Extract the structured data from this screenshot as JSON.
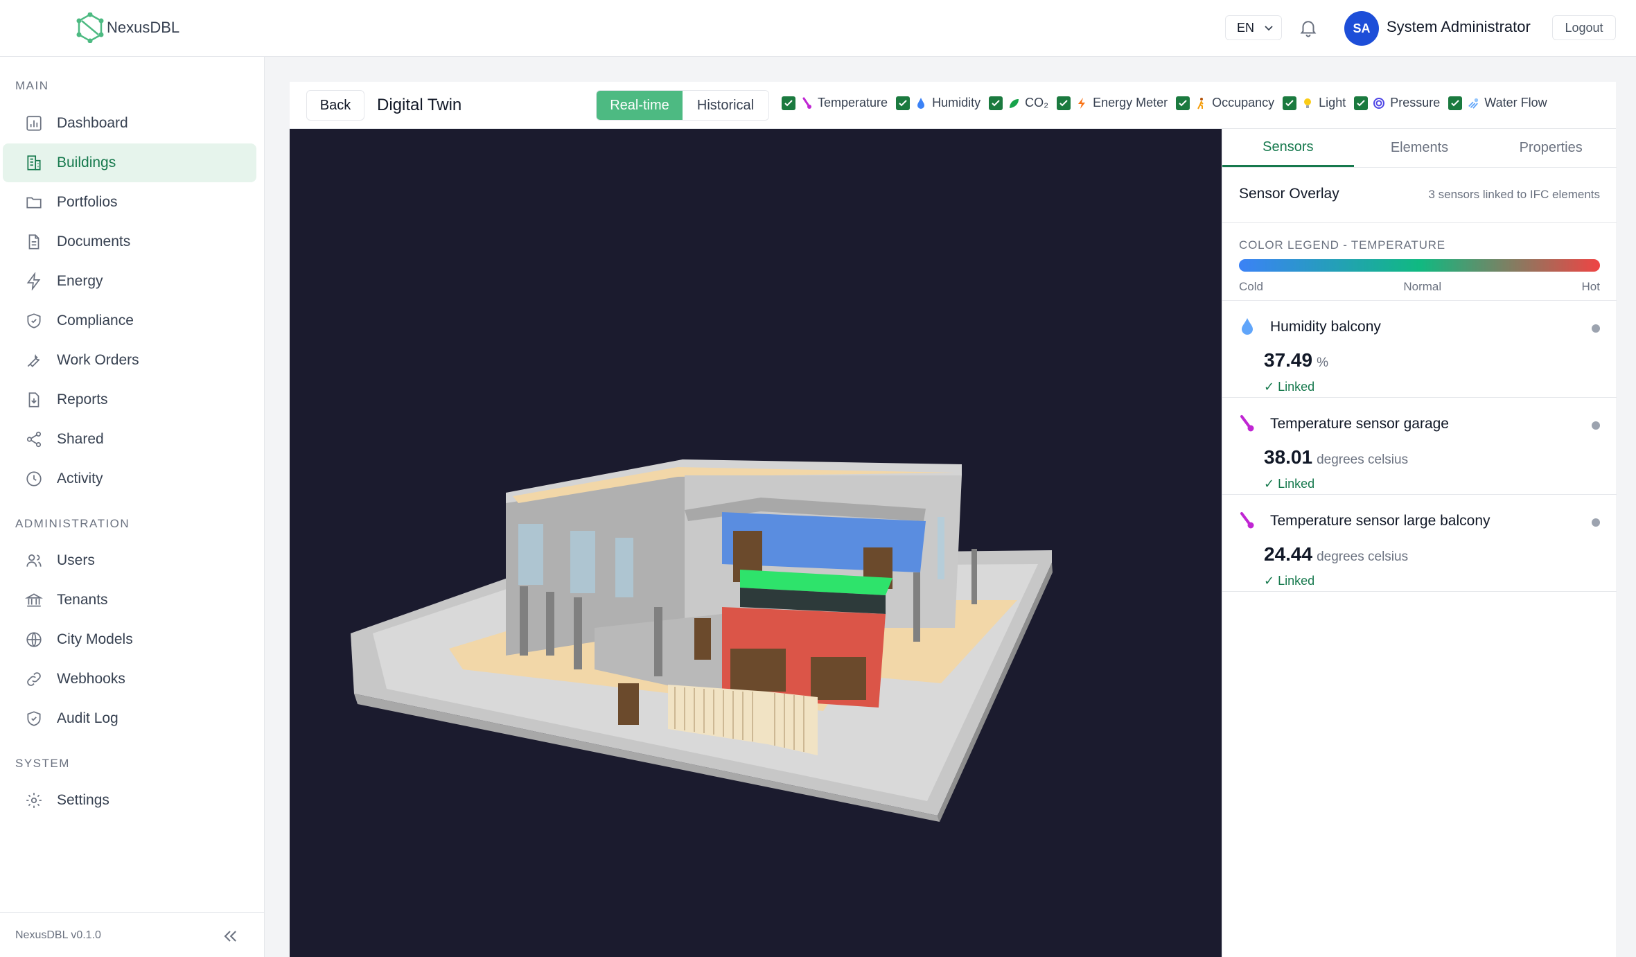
{
  "app": {
    "name": "NexusDBL",
    "version": "NexusDBL v0.1.0"
  },
  "header": {
    "language": "EN",
    "user_initials": "SA",
    "user_name": "System Administrator",
    "logout_label": "Logout"
  },
  "sidebar": {
    "sections": [
      {
        "title": "MAIN",
        "items": [
          {
            "label": "Dashboard",
            "icon": "chart-icon"
          },
          {
            "label": "Buildings",
            "icon": "building-icon",
            "active": true
          },
          {
            "label": "Portfolios",
            "icon": "folder-icon"
          },
          {
            "label": "Documents",
            "icon": "document-icon"
          },
          {
            "label": "Energy",
            "icon": "lightning-icon"
          },
          {
            "label": "Compliance",
            "icon": "shield-icon"
          },
          {
            "label": "Work Orders",
            "icon": "wrench-icon"
          },
          {
            "label": "Reports",
            "icon": "report-icon"
          },
          {
            "label": "Shared",
            "icon": "share-icon"
          },
          {
            "label": "Activity",
            "icon": "clock-icon"
          }
        ]
      },
      {
        "title": "ADMINISTRATION",
        "items": [
          {
            "label": "Users",
            "icon": "users-icon"
          },
          {
            "label": "Tenants",
            "icon": "bank-icon"
          },
          {
            "label": "City Models",
            "icon": "globe-icon"
          },
          {
            "label": "Webhooks",
            "icon": "link-icon"
          },
          {
            "label": "Audit Log",
            "icon": "shield-check-icon"
          }
        ]
      },
      {
        "title": "SYSTEM",
        "items": [
          {
            "label": "Settings",
            "icon": "gear-icon"
          }
        ]
      }
    ]
  },
  "toolbar": {
    "back_label": "Back",
    "title": "Digital Twin",
    "mode_realtime": "Real-time",
    "mode_historical": "Historical",
    "filters": [
      {
        "label": "Temperature",
        "color": "#c026d3"
      },
      {
        "label": "Humidity",
        "color": "#3b82f6"
      },
      {
        "label": "CO₂",
        "color": "#16a34a"
      },
      {
        "label": "Energy Meter",
        "color": "#f97316"
      },
      {
        "label": "Occupancy",
        "color": "#f59e0b"
      },
      {
        "label": "Light",
        "color": "#facc15"
      },
      {
        "label": "Pressure",
        "color": "#4f46e5"
      },
      {
        "label": "Water Flow",
        "color": "#60a5fa"
      }
    ]
  },
  "panel": {
    "tabs": [
      "Sensors",
      "Elements",
      "Properties"
    ],
    "active_tab": "Sensors",
    "overlay_title": "Sensor Overlay",
    "overlay_sub": "3 sensors linked to IFC elements",
    "legend_title": "COLOR LEGEND - TEMPERATURE",
    "legend_cold": "Cold",
    "legend_normal": "Normal",
    "legend_hot": "Hot",
    "sensors": [
      {
        "name": "Humidity balcony",
        "value": "37.49",
        "unit": "%",
        "status": "✓ Linked",
        "icon": "droplet-icon"
      },
      {
        "name": "Temperature sensor garage",
        "value": "38.01",
        "unit": "degrees celsius",
        "status": "✓ Linked",
        "icon": "thermometer-icon"
      },
      {
        "name": "Temperature sensor large balcony",
        "value": "24.44",
        "unit": "degrees celsius",
        "status": "✓ Linked",
        "icon": "thermometer-icon"
      }
    ]
  }
}
